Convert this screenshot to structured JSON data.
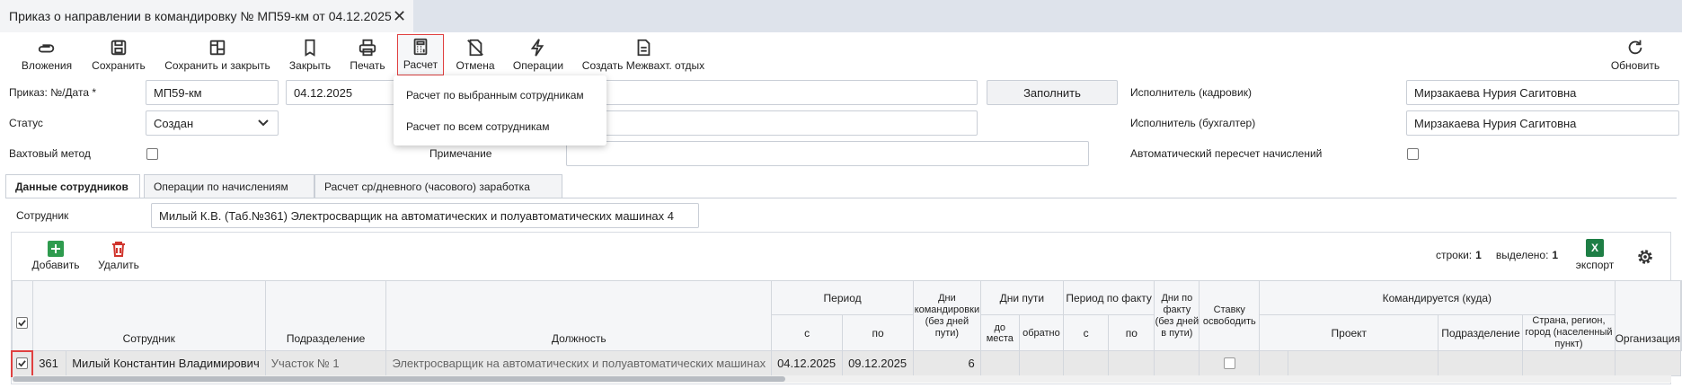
{
  "window": {
    "tab_title": "Приказ о направлении в командировку № МП59-км от 04.12.2025",
    "close_glyph": "✕"
  },
  "toolbar": {
    "attachments": "Вложения",
    "save": "Сохранить",
    "save_close": "Сохранить и закрыть",
    "close": "Закрыть",
    "print": "Печать",
    "calc": "Расчет",
    "cancel": "Отмена",
    "operations": "Операции",
    "create_rest": "Создать Межвахт. отдых",
    "refresh": "Обновить"
  },
  "calc_menu": {
    "items": [
      "Расчет по выбранным сотрудникам",
      "Расчет по всем сотрудникам"
    ]
  },
  "form": {
    "order_label": "Приказ: №/Дата *",
    "order_number": "МП59-км",
    "order_date": "04.12.2025",
    "fill_button": "Заполнить",
    "status_label": "Статус",
    "status_value": "Создан",
    "rotation_label": "Вахтовый метод",
    "note_label": "Примечание",
    "hr_label": "Исполнитель (кадровик)",
    "hr_value": "Мирзакаева Нурия Сагитовна",
    "acc_label": "Исполнитель (бухгалтер)",
    "acc_value": "Мирзакаева Нурия Сагитовна",
    "auto_label": "Автоматический пересчет начислений"
  },
  "tabs": [
    "Данные сотрудников",
    "Операции по начислениям",
    "Расчет ср/дневного (часового) заработка"
  ],
  "employee_filter": {
    "label": "Сотрудник",
    "value": "Милый К.В. (Таб.№361) Электросварщик на автоматических и полуавтоматических машинах 4"
  },
  "grid_toolbar": {
    "add": "Добавить",
    "delete": "Удалить",
    "rows_label": "строки:",
    "rows_value": "1",
    "selected_label": "выделено:",
    "selected_value": "1",
    "export": "экспорт",
    "excel_glyph": "X"
  },
  "grid": {
    "headers": {
      "employee": "Сотрудник",
      "department": "Подразделение",
      "position": "Должность",
      "period": "Период",
      "from": "с",
      "to": "по",
      "days_trip": "Дни командировки (без дней пути)",
      "travel_days": "Дни пути",
      "to_place": "до места",
      "back": "обратно",
      "period_fact": "Период по факту",
      "days_fact": "Дни по факту (без дней в пути)",
      "release_rate": "Ставку освободить",
      "sent_to": "Командируется (куда)",
      "project": "Проект",
      "sent_department": "Подразделение",
      "country": "Страна, регион, город (населенный пункт)",
      "organization": "Организация"
    },
    "rows": [
      {
        "tab_no": "361",
        "employee": "Милый Константин Владимирович",
        "department": "Участок № 1",
        "position": "Электросварщик на автоматических и полуавтоматических машинах",
        "from": "04.12.2025",
        "to": "09.12.2025",
        "days": "6"
      }
    ]
  },
  "colors": {
    "accent_red": "#e04040",
    "excel_green": "#1e7e45",
    "add_green": "#2e9b4e",
    "delete_red": "#d0342c"
  }
}
